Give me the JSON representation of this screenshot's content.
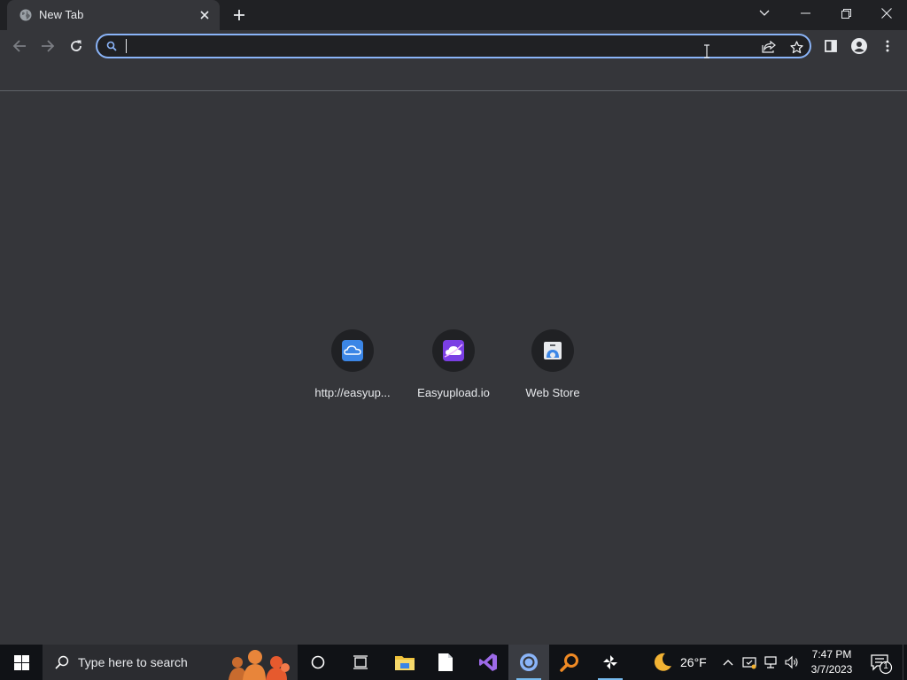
{
  "tab": {
    "title": "New Tab",
    "favicon": "globe-icon",
    "close_icon": "close-icon"
  },
  "tabstrip": {
    "newtab_icon": "plus-icon",
    "search_tabs_icon": "chevron-down-icon"
  },
  "window_controls": {
    "minimize": "minimize-icon",
    "restore": "restore-icon",
    "close": "close-icon"
  },
  "toolbar": {
    "back_icon": "back-arrow-icon",
    "forward_icon": "forward-arrow-icon",
    "reload_icon": "reload-icon",
    "share_icon": "share-icon",
    "bookmark_icon": "star-icon",
    "side_panel_icon": "side-panel-icon",
    "profile_icon": "profile-icon",
    "menu_icon": "kebab-menu-icon"
  },
  "omnibox": {
    "value": "",
    "placeholder": "",
    "icon": "search-icon"
  },
  "shortcuts": [
    {
      "label": "http://easyup...",
      "icon": "cloud-icon"
    },
    {
      "label": "Easyupload.io",
      "icon": "cloud-upload-icon"
    },
    {
      "label": "Web Store",
      "icon": "web-store-icon"
    }
  ],
  "taskbar": {
    "search_placeholder": "Type here to search",
    "apps": [
      "cortana-icon",
      "task-view-icon",
      "file-explorer-icon",
      "notepad-icon",
      "visual-studio-icon",
      "chrome-icon",
      "search-app-icon",
      "pinwheel-app-icon"
    ],
    "weather": {
      "temp": "26°F",
      "icon": "moon-icon"
    },
    "clock": {
      "time": "7:47 PM",
      "date": "3/7/2023"
    },
    "notifications": {
      "count": "1"
    }
  },
  "colors": {
    "accent": "#8ab4f8",
    "background": "#35363a",
    "tabstrip": "#202124",
    "taskbar": "#101216"
  }
}
